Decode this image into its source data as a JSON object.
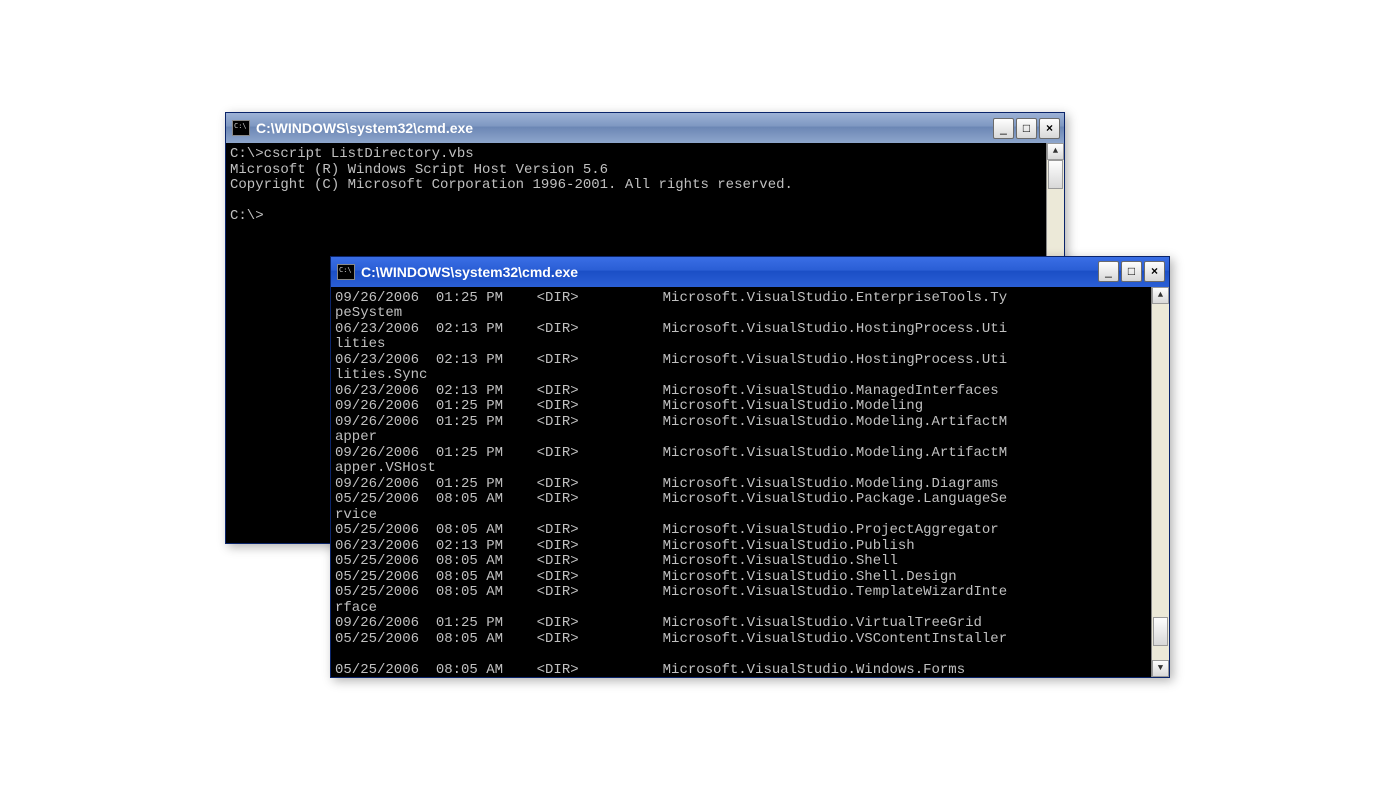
{
  "window_back": {
    "title": "C:\\WINDOWS\\system32\\cmd.exe",
    "min_label": "_",
    "max_label": "□",
    "close_label": "×",
    "lines": [
      "C:\\>cscript ListDirectory.vbs",
      "Microsoft (R) Windows Script Host Version 5.6",
      "Copyright (C) Microsoft Corporation 1996-2001. All rights reserved.",
      "",
      "C:\\>"
    ],
    "thumb": {
      "top": "0%",
      "height": "8%"
    }
  },
  "window_front": {
    "title": "C:\\WINDOWS\\system32\\cmd.exe",
    "min_label": "_",
    "max_label": "□",
    "close_label": "×",
    "lines": [
      "09/26/2006  01:25 PM    <DIR>          Microsoft.VisualStudio.EnterpriseTools.Ty",
      "peSystem",
      "06/23/2006  02:13 PM    <DIR>          Microsoft.VisualStudio.HostingProcess.Uti",
      "lities",
      "06/23/2006  02:13 PM    <DIR>          Microsoft.VisualStudio.HostingProcess.Uti",
      "lities.Sync",
      "06/23/2006  02:13 PM    <DIR>          Microsoft.VisualStudio.ManagedInterfaces",
      "09/26/2006  01:25 PM    <DIR>          Microsoft.VisualStudio.Modeling",
      "09/26/2006  01:25 PM    <DIR>          Microsoft.VisualStudio.Modeling.ArtifactM",
      "apper",
      "09/26/2006  01:25 PM    <DIR>          Microsoft.VisualStudio.Modeling.ArtifactM",
      "apper.VSHost",
      "09/26/2006  01:25 PM    <DIR>          Microsoft.VisualStudio.Modeling.Diagrams",
      "05/25/2006  08:05 AM    <DIR>          Microsoft.VisualStudio.Package.LanguageSe",
      "rvice",
      "05/25/2006  08:05 AM    <DIR>          Microsoft.VisualStudio.ProjectAggregator",
      "06/23/2006  02:13 PM    <DIR>          Microsoft.VisualStudio.Publish",
      "05/25/2006  08:05 AM    <DIR>          Microsoft.VisualStudio.Shell",
      "05/25/2006  08:05 AM    <DIR>          Microsoft.VisualStudio.Shell.Design",
      "05/25/2006  08:05 AM    <DIR>          Microsoft.VisualStudio.TemplateWizardInte",
      "rface",
      "09/26/2006  01:25 PM    <DIR>          Microsoft.VisualStudio.VirtualTreeGrid",
      "05/25/2006  08:05 AM    <DIR>          Microsoft.VisualStudio.VSContentInstaller",
      "",
      "05/25/2006  08:05 AM    <DIR>          Microsoft.VisualStudio.Windows.Forms"
    ],
    "thumb": {
      "top": "88%",
      "height": "8%"
    }
  }
}
